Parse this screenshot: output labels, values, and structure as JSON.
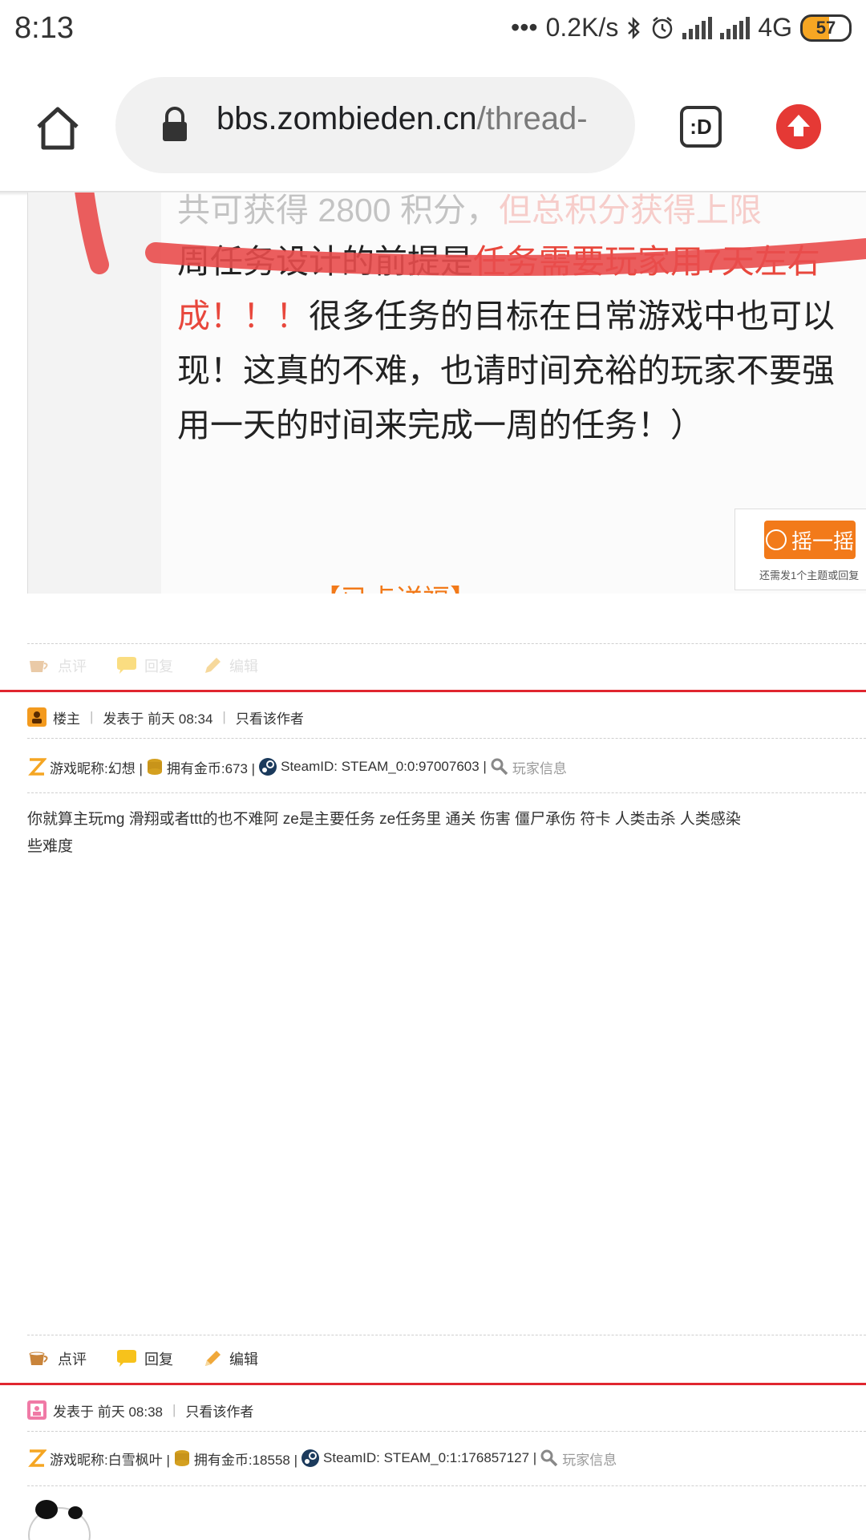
{
  "status_bar": {
    "time": "8:13",
    "net_speed": "0.2K/s",
    "network": "4G",
    "battery": "57"
  },
  "browser": {
    "url_domain": "bbs.zombieden.cn",
    "url_path": "/thread-",
    "tabs_label": ":D"
  },
  "quoted_image": {
    "line1_black": "共可获得 2800 积分，",
    "line1_red": "但总积分获得上限",
    "line2_black": "周任务设计的前提是",
    "line2_red": "任务需要玩家用7天左右",
    "line3_red": "成！！！",
    "line3_black": "很多任务的目标在日常游戏中也可以",
    "line4": "现！这真的不难，也请时间充裕的玩家不要强",
    "line5": "用一天的时间来完成一周的任务！）",
    "shake_label": "摇一摇",
    "shake_note": "还需发1个主题或回复",
    "cut_title": "【已点详福】"
  },
  "actions": {
    "comment": "点评",
    "reply": "回复",
    "edit": "编辑"
  },
  "post1": {
    "role": "楼主",
    "posted": "发表于 前天 08:34",
    "only_author": "只看该作者",
    "nickname": "游戏昵称:幻想 |",
    "coins": "拥有金币:673 |",
    "steam": "SteamID: STEAM_0:0:97007603 |",
    "player_info": "玩家信息",
    "content_line1": "你就算主玩mg 滑翔或者ttt的也不难阿 ze是主要任务 ze任务里 通关 伤害 僵尸承伤 符卡 人类击杀 人类感染",
    "content_line2": "些难度"
  },
  "post2": {
    "posted": "发表于 前天 08:38",
    "only_author": "只看该作者",
    "nickname": "游戏昵称:白雪枫叶 |",
    "coins": "拥有金币:18558 |",
    "steam": "SteamID: STEAM_0:1:176857127 |",
    "player_info": "玩家信息"
  },
  "colors": {
    "accent_red": "#e0262f",
    "orange": "#f27a1a",
    "upload_red": "#e53935"
  }
}
